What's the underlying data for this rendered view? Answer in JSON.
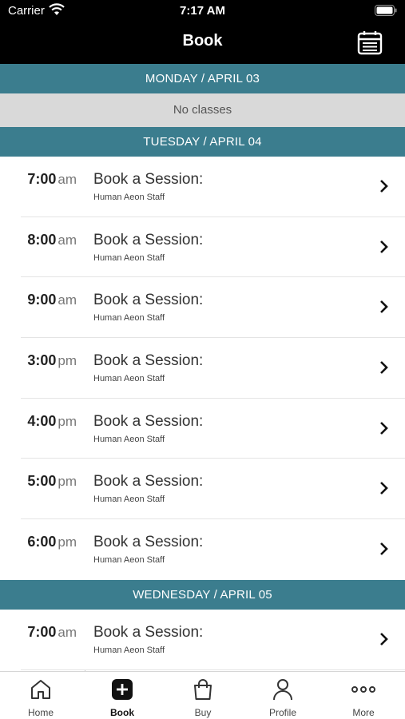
{
  "status_bar": {
    "carrier": "Carrier",
    "time": "7:17 AM"
  },
  "header": {
    "title": "Book",
    "calendar_icon": "calendar-icon"
  },
  "schedule": {
    "days": [
      {
        "label": "MONDAY / APRIL 03",
        "empty_text": "No classes",
        "sessions": []
      },
      {
        "label": "TUESDAY / APRIL 04",
        "sessions": [
          {
            "time": "7:00",
            "ampm": "am",
            "title": "Book a Session:",
            "staff": "Human Aeon Staff"
          },
          {
            "time": "8:00",
            "ampm": "am",
            "title": "Book a Session:",
            "staff": "Human Aeon Staff"
          },
          {
            "time": "9:00",
            "ampm": "am",
            "title": "Book a Session:",
            "staff": "Human Aeon Staff"
          },
          {
            "time": "3:00",
            "ampm": "pm",
            "title": "Book a Session:",
            "staff": "Human Aeon Staff"
          },
          {
            "time": "4:00",
            "ampm": "pm",
            "title": "Book a Session:",
            "staff": "Human Aeon Staff"
          },
          {
            "time": "5:00",
            "ampm": "pm",
            "title": "Book a Session:",
            "staff": "Human Aeon Staff"
          },
          {
            "time": "6:00",
            "ampm": "pm",
            "title": "Book a Session:",
            "staff": "Human Aeon Staff"
          }
        ]
      },
      {
        "label": "WEDNESDAY / APRIL 05",
        "sessions": [
          {
            "time": "7:00",
            "ampm": "am",
            "title": "Book a Session:",
            "staff": "Human Aeon Staff"
          }
        ]
      }
    ]
  },
  "tabbar": {
    "items": [
      {
        "label": "Home",
        "icon": "home-icon"
      },
      {
        "label": "Book",
        "icon": "plus-square-icon",
        "active": true
      },
      {
        "label": "Buy",
        "icon": "shopping-bag-icon"
      },
      {
        "label": "Profile",
        "icon": "person-icon"
      },
      {
        "label": "More",
        "icon": "more-dots-icon"
      }
    ]
  },
  "colors": {
    "day_header": "#3b7d8e",
    "no_classes_bg": "#d9d9d9",
    "header_bg": "#000000"
  }
}
